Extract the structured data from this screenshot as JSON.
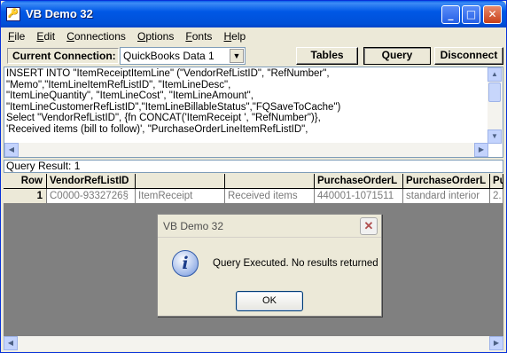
{
  "window": {
    "title": "VB Demo 32",
    "minimize": "_",
    "maximize": "□",
    "close": "✕"
  },
  "menu": [
    "File",
    "Edit",
    "Connections",
    "Options",
    "Fonts",
    "Help"
  ],
  "connection": {
    "label": "Current Connection:",
    "selected": "QuickBooks Data 1",
    "tables_label": "Tables",
    "query_label": "Query",
    "disconnect_label": "Disconnect"
  },
  "sql": {
    "text": "INSERT INTO \"ItemReceiptItemLine\" (\"VendorRefListID\", \"RefNumber\",\n\"Memo\",\"ItemLineItemRefListID\", \"ItemLineDesc\",\n\"ItemLineQuantity\", \"ItemLineCost\", \"ItemLineAmount\",\n\"ItemLineCustomerRefListID\",\"ItemLineBillableStatus\",\"FQSaveToCache\")\nSelect \"VendorRefListID\", {fn CONCAT('ItemReceipt ', \"RefNumber\")},\n'Received items (bill to follow)', \"PurchaseOrderLineItemRefListID\","
  },
  "query_result": "Query Result: 1",
  "grid": {
    "columns": [
      "Row",
      "VendorRefListID",
      "",
      "",
      "PurchaseOrderL",
      "PurchaseOrderL",
      "Pu"
    ],
    "rows": [
      [
        "1",
        "C0000-9332726§",
        "ItemReceipt",
        "Received items",
        "440001-1071511",
        "standard interior",
        "2."
      ]
    ]
  },
  "dialog": {
    "title": "VB Demo 32",
    "message": "Query Executed.  No results returned",
    "ok": "OK",
    "icon": "info-icon"
  }
}
